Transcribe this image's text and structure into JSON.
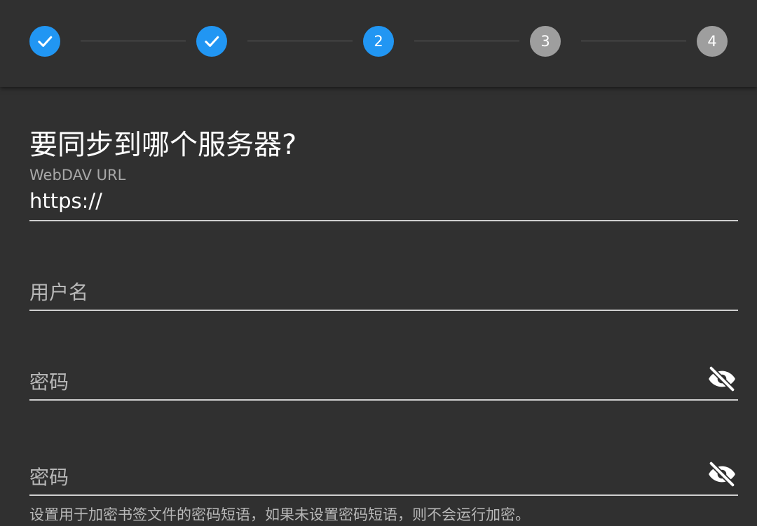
{
  "stepper": {
    "steps": [
      {
        "state": "done",
        "label": ""
      },
      {
        "state": "done",
        "label": ""
      },
      {
        "state": "active",
        "label": "2"
      },
      {
        "state": "pending",
        "label": "3"
      },
      {
        "state": "pending",
        "label": "4"
      }
    ],
    "active_color": "#2196f3",
    "pending_color": "#9e9e9e"
  },
  "form": {
    "title": "要同步到哪个服务器?",
    "url": {
      "label": "WebDAV URL",
      "value": "https://"
    },
    "username": {
      "placeholder": "用户名"
    },
    "password": {
      "placeholder": "密码",
      "toggle_icon": "visibility-off-icon"
    },
    "passphrase": {
      "placeholder": "密码",
      "toggle_icon": "visibility-off-icon",
      "helper": "设置用于加密书签文件的密码短语，如果未设置密码短语，则不会运行加密。"
    }
  }
}
